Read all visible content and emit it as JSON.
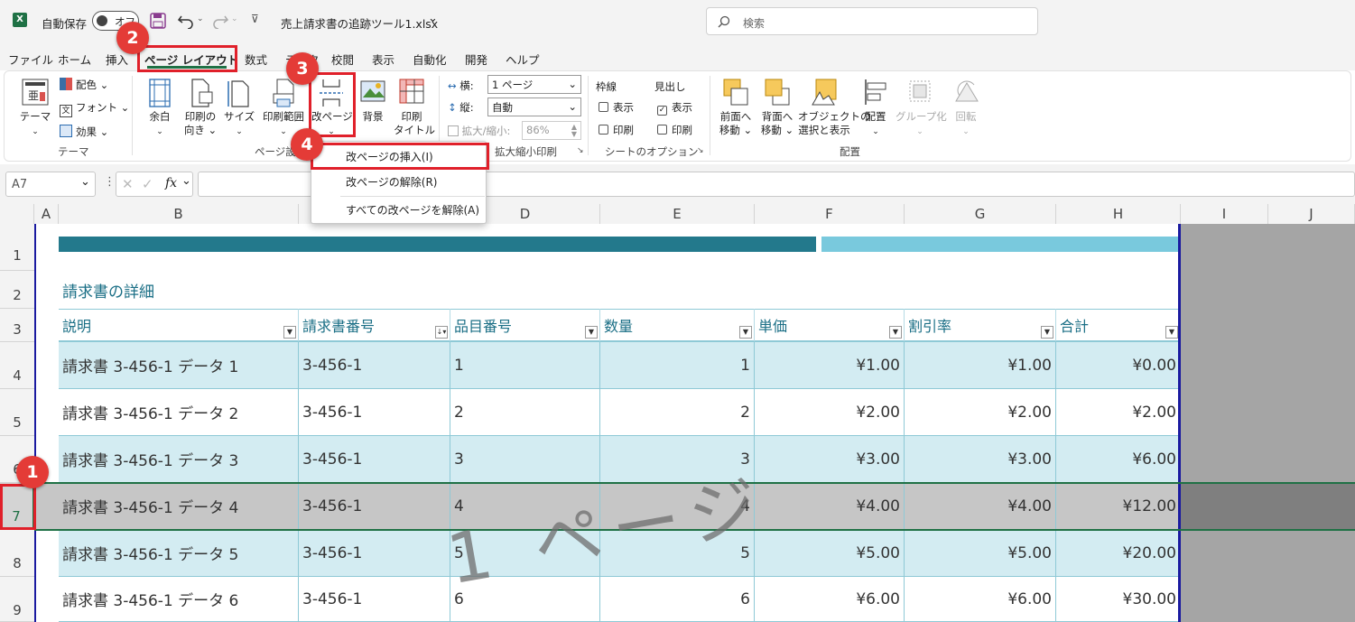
{
  "titlebar": {
    "autosave_label": "自動保存",
    "autosave_state": "オフ",
    "filename": "売上請求書の追跡ツール1.xlsx",
    "search_placeholder": "検索"
  },
  "menu": {
    "tabs": [
      "ファイル",
      "ホーム",
      "挿入",
      "ページ レイアウト",
      "数式",
      "データ",
      "校閲",
      "表示",
      "自動化",
      "開発",
      "ヘルプ"
    ]
  },
  "ribbon": {
    "themes": {
      "theme": "テーマ",
      "colors": "配色",
      "fonts": "フォント",
      "effects": "効果",
      "group": "テーマ"
    },
    "page_setup": {
      "margins": "余白",
      "orientation_1": "印刷の",
      "orientation_2": "向き",
      "size": "サイズ",
      "print_area": "印刷範囲",
      "breaks": "改ページ",
      "background": "背景",
      "print_titles_1": "印刷",
      "print_titles_2": "タイトル",
      "group": "ページ設定"
    },
    "scale": {
      "width_label": "横:",
      "width_value": "1 ページ",
      "height_label": "縦:",
      "height_value": "自動",
      "scale_label": "拡大/縮小:",
      "scale_value": "86%",
      "group": "拡大縮小印刷"
    },
    "sheet_options": {
      "gridlines": "枠線",
      "headings": "見出し",
      "view1": "表示",
      "print1": "印刷",
      "view2": "表示",
      "print2": "印刷",
      "group": "シートのオプション"
    },
    "arrange": {
      "bring_forward_1": "前面へ",
      "bring_forward_2": "移動",
      "send_backward_1": "背面へ",
      "send_backward_2": "移動",
      "selection_pane_1": "オブジェクトの",
      "selection_pane_2": "選択と表示",
      "align": "配置",
      "group_btn": "グループ化",
      "rotate": "回転",
      "group": "配置"
    }
  },
  "formula": {
    "namebox": "A7",
    "fx": "fx",
    "content": ""
  },
  "dropdown": {
    "items": [
      "改ページの挿入(I)",
      "改ページの解除(R)",
      "すべての改ページを解除(A)"
    ]
  },
  "sheet": {
    "columns": [
      "A",
      "B",
      "C",
      "D",
      "E",
      "F",
      "G",
      "H",
      "I",
      "J"
    ],
    "rows": [
      "1",
      "2",
      "3",
      "4",
      "5",
      "6",
      "7",
      "8",
      "9"
    ],
    "section_title": "請求書の詳細",
    "headers": [
      "説明",
      "請求書番号",
      "品目番号",
      "数量",
      "単価",
      "割引率",
      "合計"
    ],
    "data": [
      [
        "請求書 3-456-1 データ 1",
        "3-456-1",
        "1",
        "1",
        "¥1.00",
        "¥1.00",
        "¥0.00"
      ],
      [
        "請求書 3-456-1 データ 2",
        "3-456-1",
        "2",
        "2",
        "¥2.00",
        "¥2.00",
        "¥2.00"
      ],
      [
        "請求書 3-456-1 データ 3",
        "3-456-1",
        "3",
        "3",
        "¥3.00",
        "¥3.00",
        "¥6.00"
      ],
      [
        "請求書 3-456-1 データ 4",
        "3-456-1",
        "4",
        "4",
        "¥4.00",
        "¥4.00",
        "¥12.00"
      ],
      [
        "請求書 3-456-1 データ 5",
        "3-456-1",
        "5",
        "5",
        "¥5.00",
        "¥5.00",
        "¥20.00"
      ],
      [
        "請求書 3-456-1 データ 6",
        "3-456-1",
        "6",
        "6",
        "¥6.00",
        "¥6.00",
        "¥30.00"
      ]
    ],
    "watermark": "1 ページ"
  },
  "callouts": [
    "1",
    "2",
    "3",
    "4"
  ],
  "colors": {
    "accent_dark": "#23798c",
    "accent_light": "#79c9dd",
    "row_band": "#d3ecf2",
    "selected_row": "#c6c6c6",
    "callout": "#e43b37"
  }
}
